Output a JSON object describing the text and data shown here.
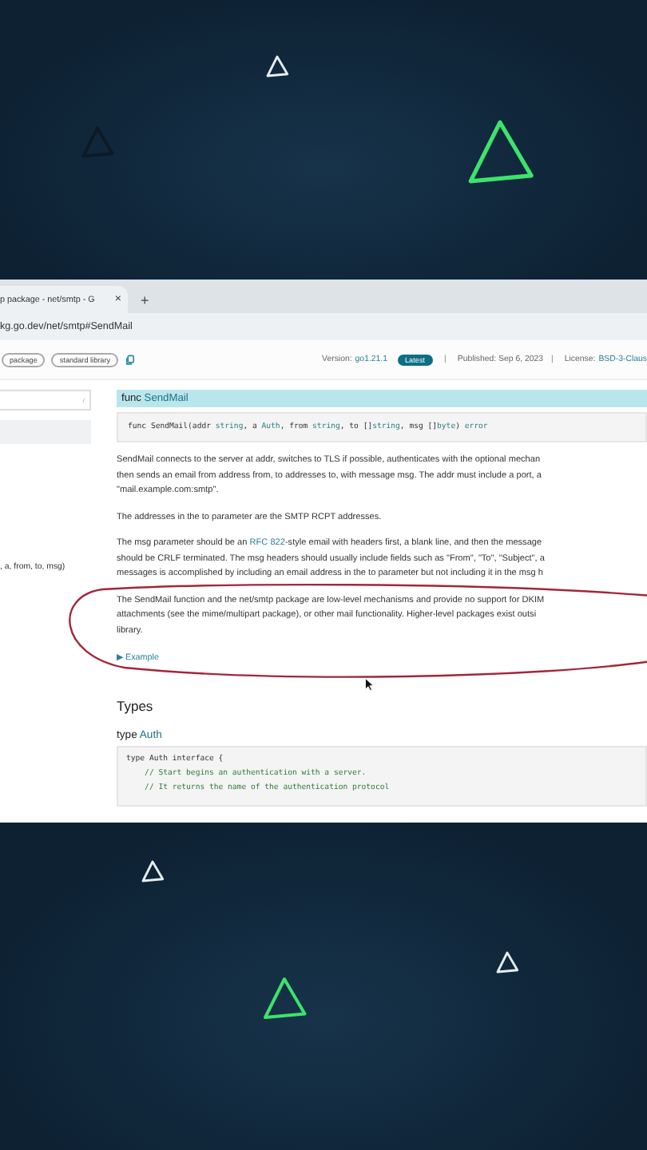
{
  "browser": {
    "tab": {
      "title": "p package - net/smtp - G",
      "close": "×",
      "selected": true
    },
    "new_tab": "+",
    "address": "kg.go.dev/net/smtp#SendMail"
  },
  "header": {
    "chips": [
      "package",
      "standard library"
    ],
    "version_label": "Version:",
    "version": "go1.21.1",
    "badge": "Latest",
    "separator_1": "|",
    "published": "Published: Sep 6, 2023",
    "separator_2": "|",
    "license_label": "License:",
    "license": "BSD-3-Claus"
  },
  "sidebar": {
    "search_hint": "/",
    "call_text": ", a, from, to, msg)"
  },
  "func": {
    "keyword": "func",
    "name": "SendMail",
    "signature": [
      {
        "t": "func SendMail(addr ",
        "kind": "plain"
      },
      {
        "t": "string",
        "kind": "type"
      },
      {
        "t": ", a ",
        "kind": "plain"
      },
      {
        "t": "Auth",
        "kind": "type"
      },
      {
        "t": ", from ",
        "kind": "plain"
      },
      {
        "t": "string",
        "kind": "type"
      },
      {
        "t": ", to []",
        "kind": "plain"
      },
      {
        "t": "string",
        "kind": "type"
      },
      {
        "t": ", msg []",
        "kind": "plain"
      },
      {
        "t": "byte",
        "kind": "type"
      },
      {
        "t": ") ",
        "kind": "plain"
      },
      {
        "t": "error",
        "kind": "type"
      }
    ]
  },
  "paragraphs": [
    [
      [
        {
          "t": "SendMail connects to the server at addr, switches to TLS if possible, authenticates with the optional mechan",
          "kind": "text"
        }
      ],
      [
        {
          "t": "then sends an email from address from, to addresses to, with message msg. The addr must include a port, a",
          "kind": "text"
        }
      ],
      [
        {
          "t": "\"mail.example.com:smtp\".",
          "kind": "text"
        }
      ]
    ],
    [
      [
        {
          "t": "The addresses in the to parameter are the SMTP RCPT addresses.",
          "kind": "text"
        }
      ]
    ],
    [
      [
        {
          "t": "The msg parameter should be an ",
          "kind": "text"
        },
        {
          "t": "RFC 822",
          "kind": "link"
        },
        {
          "t": "-style email with headers first, a blank line, and then the message",
          "kind": "text"
        }
      ],
      [
        {
          "t": "should be CRLF terminated. The msg headers should usually include fields such as \"From\", \"To\", \"Subject\", a",
          "kind": "text"
        }
      ],
      [
        {
          "t": "messages is accomplished by including an email address in the to parameter but not including it in the msg h",
          "kind": "text"
        }
      ]
    ],
    [
      [
        {
          "t": "The SendMail function and the net/smtp package are low-level mechanisms and provide no support for DKIM",
          "kind": "text"
        }
      ],
      [
        {
          "t": "attachments (see the mime/multipart package), or other mail functionality. Higher-level packages exist outsi",
          "kind": "text"
        }
      ],
      [
        {
          "t": "library.",
          "kind": "text"
        }
      ]
    ]
  ],
  "example": {
    "marker": "▶",
    "label": "Example",
    "expanded": false
  },
  "types_heading": "Types",
  "type": {
    "keyword": "type",
    "name": "Auth"
  },
  "code": [
    {
      "t": "type Auth interface {",
      "kind": "code"
    },
    {
      "t": "    // Start begins an authentication with a server.",
      "kind": "comment"
    },
    {
      "t": "    // It returns the name of the authentication protocol",
      "kind": "comment"
    }
  ]
}
